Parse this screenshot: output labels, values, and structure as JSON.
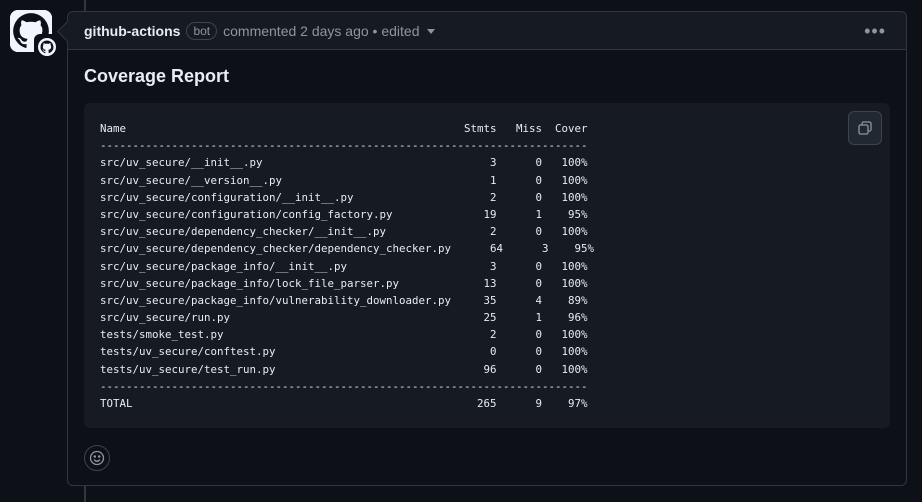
{
  "comment": {
    "author": "github-actions",
    "badge": "bot",
    "meta": "commented 2 days ago • edited",
    "menu_icon": "kebab-horizontal-icon"
  },
  "report": {
    "title": "Coverage Report",
    "lines": [
      "Name                                                    Stmts   Miss  Cover",
      "---------------------------------------------------------------------------",
      "src/uv_secure/__init__.py                                   3      0   100%",
      "src/uv_secure/__version__.py                                1      0   100%",
      "src/uv_secure/configuration/__init__.py                     2      0   100%",
      "src/uv_secure/configuration/config_factory.py              19      1    95%",
      "src/uv_secure/dependency_checker/__init__.py                2      0   100%",
      "src/uv_secure/dependency_checker/dependency_checker.py      64      3    95%",
      "src/uv_secure/package_info/__init__.py                      3      0   100%",
      "src/uv_secure/package_info/lock_file_parser.py             13      0   100%",
      "src/uv_secure/package_info/vulnerability_downloader.py     35      4    89%",
      "src/uv_secure/run.py                                       25      1    96%",
      "tests/smoke_test.py                                         2      0   100%",
      "tests/uv_secure/conftest.py                                 0      0   100%",
      "tests/uv_secure/test_run.py                                96      0   100%",
      "---------------------------------------------------------------------------",
      "TOTAL                                                     265      9    97%"
    ]
  },
  "icons": {
    "avatar": "github-actions-avatar-icon",
    "copy": "copy-icon",
    "reaction": "smiley-icon"
  }
}
